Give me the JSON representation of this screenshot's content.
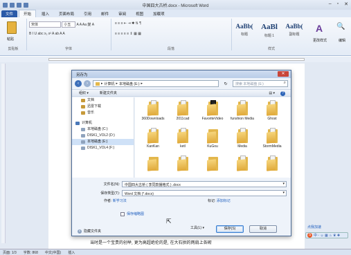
{
  "window": {
    "title": "中国四大古桥.docx - Microsoft Word",
    "controls": [
      "–",
      "▫",
      "✕"
    ]
  },
  "ribbon": {
    "tabs": [
      {
        "label": "文件",
        "kind": "file"
      },
      {
        "label": "开始",
        "kind": "active"
      },
      {
        "label": "插入",
        "kind": ""
      },
      {
        "label": "页面布局",
        "kind": ""
      },
      {
        "label": "引用",
        "kind": ""
      },
      {
        "label": "邮件",
        "kind": ""
      },
      {
        "label": "审阅",
        "kind": ""
      },
      {
        "label": "视图",
        "kind": ""
      },
      {
        "label": "加载项",
        "kind": ""
      }
    ],
    "clipboard": {
      "paste": "粘贴",
      "group": "剪贴板"
    },
    "font": {
      "name": "宋体",
      "size": "小五",
      "group": "字体",
      "row1": "A  A  Aa  變  A",
      "row2": "B  I  U  abc  x₂  x²  A  ab  A  A"
    },
    "paragraph": {
      "group": "段落",
      "row1": "≡  ≡  ≡  ⇤  ⇥  ✱  ⇅  ¶",
      "row2": "≡  ≡  ≡  ≡  ≡  ⇕  ▦  ▦"
    },
    "styles": {
      "group": "样式",
      "items": [
        {
          "sample": "AaBb(",
          "name": "标题"
        },
        {
          "sample": "AaBl",
          "name": "标题 1"
        },
        {
          "sample": "AaBb(",
          "name": "副标题"
        }
      ],
      "change": "更改样式",
      "edit": "编辑"
    }
  },
  "dialog": {
    "title": "另存为",
    "close": "✕",
    "address": {
      "parts": [
        "计算机",
        "本地磁盘 (E:)"
      ]
    },
    "search_placeholder": "搜索 本地磁盘 (E:)",
    "commands": {
      "organize": "组织 ▾",
      "new_folder": "新建文件夹",
      "view": "▤ ▾",
      "help": "?"
    },
    "nav": [
      {
        "label": "文档",
        "type": "sub lib"
      },
      {
        "label": "迅雷下载",
        "type": "sub lib"
      },
      {
        "label": "音乐",
        "type": "sub lib"
      },
      {
        "label": "",
        "type": "gap"
      },
      {
        "label": "计算机",
        "type": "comp"
      },
      {
        "label": "本地磁盘 (C:)",
        "type": "sub"
      },
      {
        "label": "DISK1_VOL2 (D:)",
        "type": "sub"
      },
      {
        "label": "本地磁盘 (E:)",
        "type": "sub sel"
      },
      {
        "label": "DISK1_VOL4 (F:)",
        "type": "sub"
      }
    ],
    "files": [
      {
        "name": "360Downloads",
        "style": ""
      },
      {
        "name": "2011cad",
        "style": ""
      },
      {
        "name": "FavoriteVideo",
        "style": "dark"
      },
      {
        "name": "funshion Media",
        "style": ""
      },
      {
        "name": "Ghost",
        "style": ""
      },
      {
        "name": "KanKan",
        "style": ""
      },
      {
        "name": "ketl",
        "style": ""
      },
      {
        "name": "KuGou",
        "style": "plain"
      },
      {
        "name": "Media",
        "style": ""
      },
      {
        "name": "StormMedia",
        "style": ""
      },
      {
        "name": "",
        "style": "plain"
      },
      {
        "name": "",
        "style": ""
      },
      {
        "name": "",
        "style": "plain"
      },
      {
        "name": "",
        "style": ""
      },
      {
        "name": "",
        "style": ""
      }
    ],
    "filename": {
      "label": "文件名(N):",
      "value": "中国四大古桥 ( 李同款播格式 ) .docx"
    },
    "filetype": {
      "label": "保存类型(T):",
      "value": "Word 文档 (*.docx)"
    },
    "authors": {
      "label": "作者:",
      "value": "新学习法"
    },
    "tags": {
      "label": "标记:",
      "value": "添加标记"
    },
    "thumbnail": {
      "label": "保存缩略图"
    },
    "hide_folders": "隐藏文件夹",
    "tools": "工具(L) ▾",
    "save": "保存(S)",
    "cancel": "取消"
  },
  "document": {
    "visible_line": "当时是一个宝贵的创举, 更为高超绝伦的是, 在大石拱的两肩上各砌"
  },
  "statusbar": {
    "items": [
      "页面: 1/3",
      "字数: 868",
      "中文(中国)",
      "插入"
    ]
  },
  "overlay": {
    "tag": "点我加速",
    "ime": "中 ◦ ☺ ▦ ♨ ♛ ✚"
  }
}
